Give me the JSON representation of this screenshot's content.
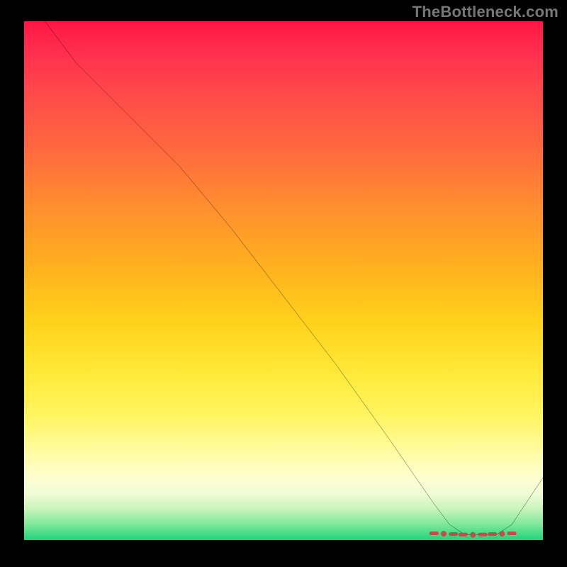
{
  "watermark": "TheBottleneck.com",
  "colors": {
    "line": "#000000",
    "marker": "#c64b4b"
  },
  "chart_data": {
    "type": "line",
    "title": "",
    "xlabel": "",
    "ylabel": "",
    "xlim": [
      0,
      100
    ],
    "ylim": [
      0,
      100
    ],
    "grid": false,
    "legend": null,
    "x": [
      4,
      10,
      20,
      30,
      40,
      50,
      60,
      70,
      79,
      82,
      85,
      88,
      91,
      94,
      100
    ],
    "values": [
      100,
      92,
      82,
      72,
      60,
      47,
      34,
      20,
      7,
      3,
      1,
      1,
      1,
      3,
      12
    ],
    "annotations": [],
    "marker_region_x": [
      79,
      94
    ],
    "marker_style": "dashed-dots-red"
  }
}
